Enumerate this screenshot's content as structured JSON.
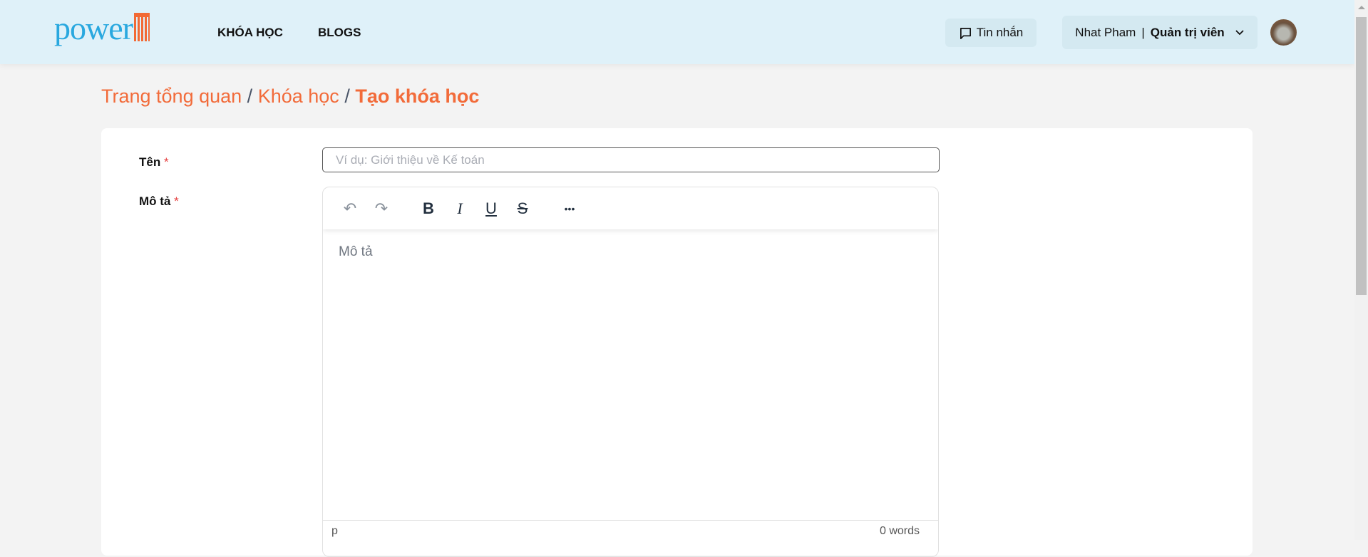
{
  "header": {
    "logo": "power5",
    "nav": [
      "KHÓA HỌC",
      "BLOGS"
    ],
    "messages_label": "Tin nhắn",
    "user_name": "Nhat Pham",
    "user_sep": "|",
    "user_role": "Quản trị viên"
  },
  "breadcrumb": {
    "items": [
      "Trang tổng quan",
      "Khóa học"
    ],
    "sep": "/",
    "current": "Tạo khóa học"
  },
  "form": {
    "name_label": "Tên",
    "required_mark": "*",
    "name_placeholder": "Ví dụ: Giới thiệu về Kế toán",
    "desc_label": "Mô tả",
    "desc_placeholder": "Mô tả",
    "toolbar": {
      "undo": "↶",
      "redo": "↷",
      "bold": "B",
      "italic": "I",
      "underline": "U",
      "strike": "S",
      "more": "•••"
    },
    "status_path": "p",
    "word_count": "0 words"
  },
  "colors": {
    "accent": "#f26b3a",
    "header_bg": "#dff1f9",
    "logo_blue": "#29a8df"
  }
}
